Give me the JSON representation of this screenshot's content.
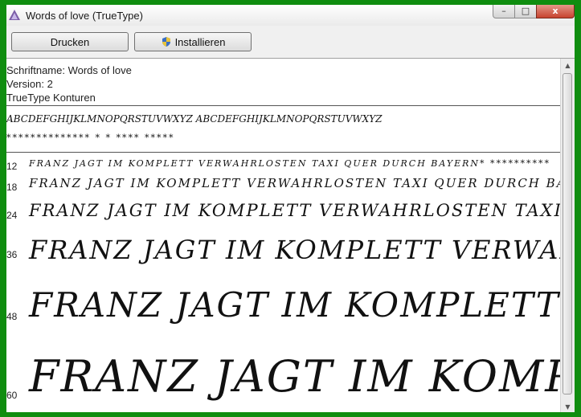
{
  "window": {
    "title": "Words of love (TrueType)"
  },
  "window_controls": {
    "min": "–",
    "max": "□",
    "close": "x"
  },
  "toolbar": {
    "print_label": "Drucken",
    "install_label": "Installieren"
  },
  "info": {
    "font_name": "Schriftname: Words of love",
    "version": "Version: 2",
    "type": "TrueType Konturen"
  },
  "preview": {
    "alphabet_line": "ABCDEFGHIJKLMNOPQRSTUVWXYZ  ABCDEFGHIJKLMNOPQRSTUVWXYZ",
    "stars_line": "**************  *  *   ****   *****",
    "sample_text": "FRANZ JAGT IM KOMPLETT VERWAHRLOSTEN TAXI QUER DURCH BAYERN",
    "sizes": [
      {
        "label": "12",
        "text": "FRANZ JAGT IM KOMPLETT VERWAHRLOSTEN TAXI QUER DURCH BAYERN* **********"
      },
      {
        "label": "18",
        "text": "FRANZ JAGT IM KOMPLETT VERWAHRLOSTEN TAXI QUER DURCH BAYERN* *****"
      },
      {
        "label": "24",
        "text": "FRANZ JAGT IM KOMPLETT VERWAHRLOSTEN TAXI QUER DURCH"
      },
      {
        "label": "36",
        "text": "FRANZ JAGT IM KOMPLETT VERWAHRLOS"
      },
      {
        "label": "48",
        "text": "FRANZ JAGT IM KOMPLETT VE"
      },
      {
        "label": "60",
        "text": "FRANZ JAGT IM KOMPLE"
      }
    ]
  }
}
